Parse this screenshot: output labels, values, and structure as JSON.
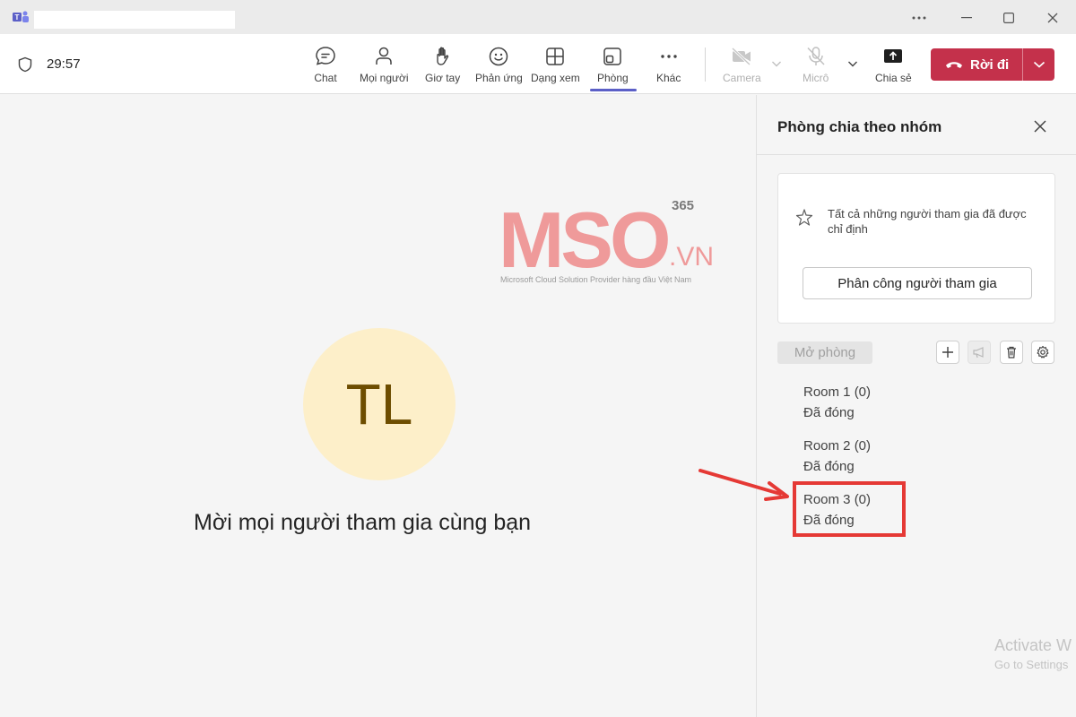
{
  "titlebar": {
    "controls": [
      "more-icon",
      "minimize-icon",
      "maximize-icon",
      "close-icon"
    ]
  },
  "toolbar": {
    "timer": "29:57",
    "items": {
      "chat": "Chat",
      "people": "Mọi người",
      "raise_hand": "Giơ tay",
      "react": "Phản ứng",
      "view": "Dạng xem",
      "rooms": "Phòng",
      "more": "Khác",
      "camera": "Camera",
      "mic": "Micrô",
      "share": "Chia sẻ"
    },
    "leave_label": "Rời đi",
    "accent_color": "#5b5fc7",
    "leave_color": "#c4314b"
  },
  "stage": {
    "avatar_initials": "TL",
    "invite_text": "Mời mọi người tham gia cùng bạn"
  },
  "watermark": {
    "brand": "MSO",
    "tld": ".VN",
    "sup": "365",
    "tagline": "Microsoft Cloud Solution Provider hàng đầu Việt Nam"
  },
  "panel": {
    "title": "Phòng chia theo nhóm",
    "info_text": "Tất cả những người tham gia đã được chỉ định",
    "assign_label": "Phân công người tham gia",
    "open_label": "Mở phòng",
    "rooms": [
      {
        "name": "Room 1  (0)",
        "status": "Đã đóng"
      },
      {
        "name": "Room 2  (0)",
        "status": "Đã đóng"
      },
      {
        "name": "Room 3  (0)",
        "status": "Đã đóng"
      }
    ]
  },
  "os_overlay": {
    "line1": "Activate W",
    "line2": "Go to Settings"
  }
}
